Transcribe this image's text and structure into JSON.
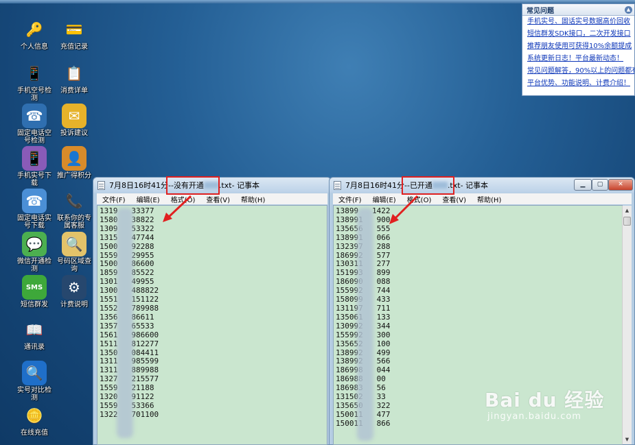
{
  "desktop_icons": [
    {
      "label": "个人信息",
      "icon": "key-icon"
    },
    {
      "label": "充值记录",
      "icon": "card-icon"
    },
    {
      "label": "手机空号检测",
      "icon": "phone-icon"
    },
    {
      "label": "消费详单",
      "icon": "clipboard-icon"
    },
    {
      "label": "固定电话空号检测",
      "icon": "telephone-icon"
    },
    {
      "label": "投诉建议",
      "icon": "envelope-icon"
    },
    {
      "label": "手机实号下载",
      "icon": "mobile-purple-icon"
    },
    {
      "label": "推广得积分",
      "icon": "promoter-icon"
    },
    {
      "label": "固定电话实号下载",
      "icon": "blue-phone-icon"
    },
    {
      "label": "联系你的专属客服",
      "icon": "red-handset-icon"
    },
    {
      "label": "微信开通检测",
      "icon": "wechat-icon"
    },
    {
      "label": "号码区域查询",
      "icon": "map-search-icon"
    },
    {
      "label": "短信群发",
      "icon": "sms-icon"
    },
    {
      "label": "计费说明",
      "icon": "settings-panel-icon"
    },
    {
      "label": "通讯录",
      "icon": "address-book-icon"
    },
    {
      "label": "实号对比检测",
      "icon": "search-icon"
    },
    {
      "label": "在线充值",
      "icon": "coins-icon"
    }
  ],
  "faq": {
    "title": "常见问题",
    "items": [
      "手机实号、固话实号数据高价回收",
      "短信群发SDK接口，二次开发接口",
      "推荐朋友使用可获得10%余额提成",
      "系统更新日志！平台最新动态！",
      "常见问题解答，90%以上的问题都有",
      "平台优势、功能说明、计费介绍！"
    ]
  },
  "menu": [
    "文件(F)",
    "编辑(E)",
    "格式(O)",
    "查看(V)",
    "帮助(H)"
  ],
  "window_left": {
    "title_prefix": "7月8日16时41分--",
    "title_file": "没有开通",
    "title_ext": ".txt",
    "title_suffix": " - 记事本",
    "lines": [
      "1319   33377",
      "1580   38822",
      "1309   53322",
      "1315   47744",
      "1500   92288",
      "1559   29955",
      "1500   86600",
      "1859   85522",
      "1301   49955",
      "1300   488822",
      "1551   151122",
      "1552   789988",
      "1356   86611",
      "1357   65533",
      "1561   986600",
      "1511   812277",
      "1350   084411",
      "1311   985599",
      "1311   889988",
      "1327   215577",
      "1559   21188",
      "1320   91122",
      "1559   53366",
      "1322   701100"
    ]
  },
  "window_right": {
    "title_prefix": "7月8日16时41分--",
    "title_file": "已开通",
    "title_ext": ".txt",
    "title_suffix": " - 记事本",
    "lines": [
      "13899   1422",
      "138991   900",
      "135656   555",
      "138991   066",
      "132397   288",
      "186992   577",
      "130311   277",
      "151993   899",
      "186090   088",
      "155992   744",
      "158099   433",
      "131197   711",
      "135061   133",
      "130992   344",
      "155992   300",
      "135652   100",
      "138992   499",
      "138992   566",
      "186998   044",
      "186988   00",
      "186983   56",
      "131502   33",
      "135650   322",
      "150011   477",
      "150011   866"
    ]
  },
  "watermark": {
    "brand": "Bai du 经验",
    "url": "jingyan.baidu.com"
  }
}
